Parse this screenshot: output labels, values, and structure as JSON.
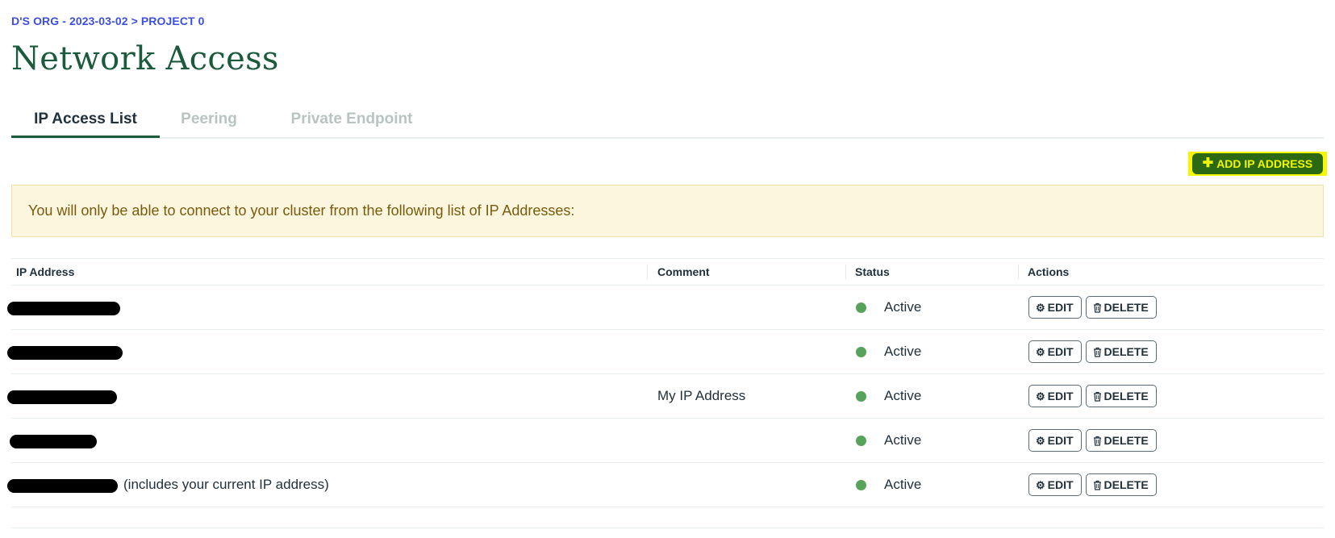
{
  "breadcrumb": "D'S ORG - 2023-03-02 > PROJECT 0",
  "page_title": "Network Access",
  "tabs": [
    {
      "label": "IP Access List",
      "active": true
    },
    {
      "label": "Peering",
      "active": false
    },
    {
      "label": "Private Endpoint",
      "active": false
    }
  ],
  "add_button": {
    "icon": "plus-icon",
    "label": "ADD IP ADDRESS"
  },
  "banner_text": "You will only be able to connect to your cluster from the following list of IP Addresses:",
  "table": {
    "headers": [
      "IP Address",
      "Comment",
      "Status",
      "Actions"
    ],
    "rows": [
      {
        "ip_note": "",
        "comment": "",
        "status": "Active",
        "edit_label": "EDIT",
        "delete_label": "DELETE"
      },
      {
        "ip_note": "",
        "comment": "",
        "status": "Active",
        "edit_label": "EDIT",
        "delete_label": "DELETE"
      },
      {
        "ip_note": "",
        "comment": "My IP Address",
        "status": "Active",
        "edit_label": "EDIT",
        "delete_label": "DELETE"
      },
      {
        "ip_note": "",
        "comment": "",
        "status": "Active",
        "edit_label": "EDIT",
        "delete_label": "DELETE"
      },
      {
        "ip_note": "(includes your current IP address)",
        "comment": "",
        "status": "Active",
        "edit_label": "EDIT",
        "delete_label": "DELETE"
      }
    ]
  },
  "colors": {
    "breadcrumb": "#3d4fe0",
    "title": "#1c5a3c",
    "add_button_bg": "#2b6a12",
    "add_button_text": "#f0f700",
    "highlight": "#f6f600",
    "banner_bg": "#fbf6dd",
    "banner_text": "#7a5a0e",
    "status_active": "#57a35c"
  },
  "icons": {
    "edit": "gear-icon",
    "delete": "trash-icon",
    "status": "status-dot"
  }
}
